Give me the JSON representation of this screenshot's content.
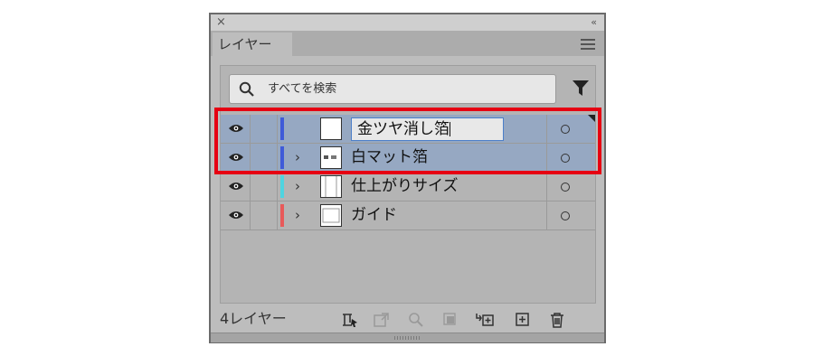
{
  "panel": {
    "close_label": "×",
    "collapse_label": "‹‹",
    "tab_label": "レイヤー"
  },
  "search": {
    "placeholder": "すべてを検索"
  },
  "layers": [
    {
      "name": "金ツヤ消し箔",
      "color": "#3f5bd8",
      "selected": true,
      "editing": true
    },
    {
      "name": "白マット箔",
      "color": "#3f5bd8",
      "selected": true,
      "editing": false
    },
    {
      "name": "仕上がりサイズ",
      "color": "#4fd4e0",
      "selected": false,
      "editing": false
    },
    {
      "name": "ガイド",
      "color": "#e85a5a",
      "selected": false,
      "editing": false
    }
  ],
  "footer": {
    "layer_count": "4レイヤー"
  },
  "colors": {
    "selection": "#96a8c2",
    "highlight_box": "#e60012"
  }
}
